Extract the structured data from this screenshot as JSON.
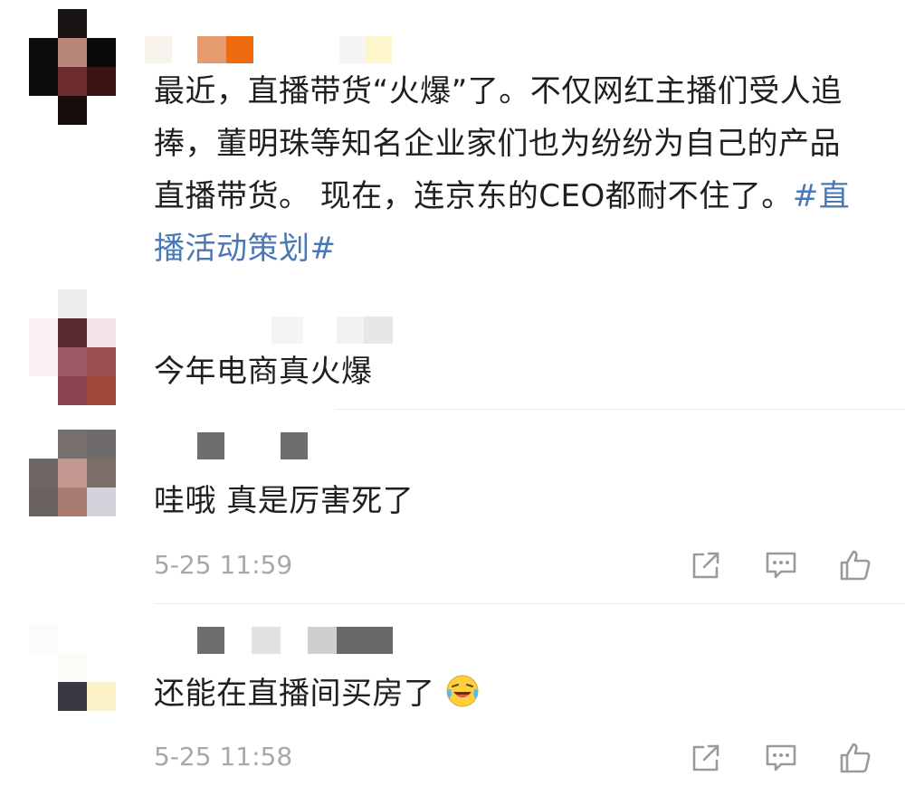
{
  "posts": [
    {
      "text": "最近，直播带货“火爆”了。不仅网红主播们受人追捧，董明珠等知名企业家们也为纷纷为自己的产品直播带货。 现在，连京东的CEO都耐不住了。",
      "hashtag": "#直播活动策划#"
    },
    {
      "text": "今年电商真火爆"
    },
    {
      "text": "哇哦 真是厉害死了",
      "time": "5-25 11:59"
    },
    {
      "text": "还能在直播间买房了",
      "emoji": "laughing-crying-emoji",
      "time": "5-25 11:58"
    }
  ],
  "actions": [
    "share-icon",
    "comment-icon",
    "like-icon"
  ],
  "colors": {
    "hashtag": "#4a78b5",
    "meta": "#a8a8a8",
    "icon": "#9a9a9a"
  }
}
